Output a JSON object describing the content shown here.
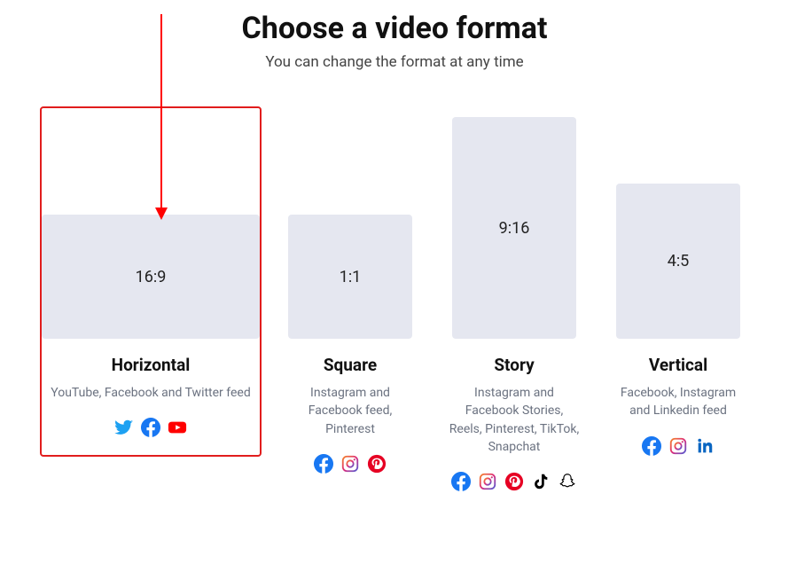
{
  "header": {
    "title": "Choose a video format",
    "subtitle": "You can change the format at any time"
  },
  "formats": [
    {
      "ratio": "16:9",
      "name": "Horizontal",
      "desc": "YouTube, Facebook and Twitter feed",
      "selected": true
    },
    {
      "ratio": "1:1",
      "name": "Square",
      "desc": "Instagram and Facebook feed, Pinterest",
      "selected": false
    },
    {
      "ratio": "9:16",
      "name": "Story",
      "desc": "Instagram and Facebook Stories, Reels, Pinterest, TikTok, Snapchat",
      "selected": false
    },
    {
      "ratio": "4:5",
      "name": "Vertical",
      "desc": "Facebook, Instagram and Linkedin feed",
      "selected": false
    }
  ]
}
